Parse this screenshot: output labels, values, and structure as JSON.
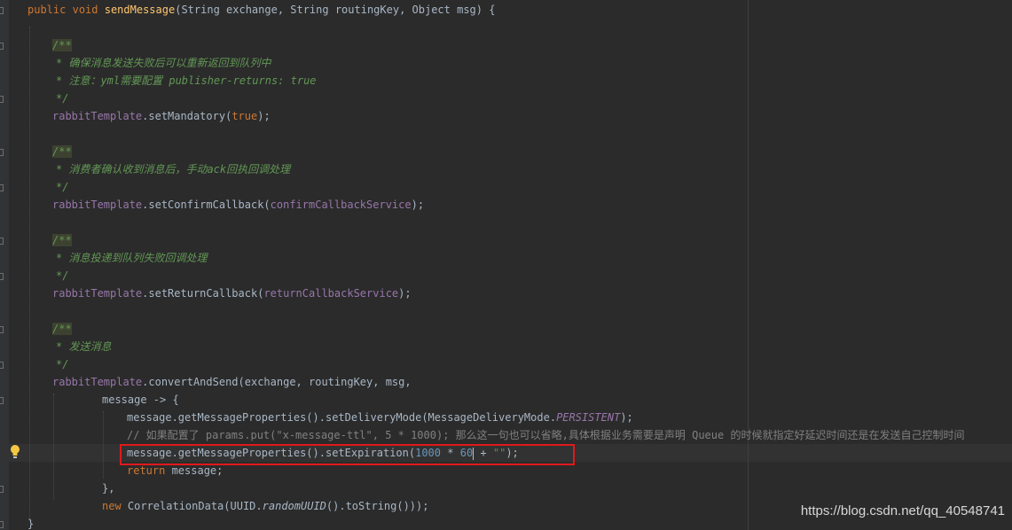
{
  "editor": {
    "colors": {
      "background": "#2b2b2b",
      "keyword": "#cc7832",
      "method": "#ffc66d",
      "field": "#9876aa",
      "number": "#6897bb",
      "string": "#6a8759",
      "javadoc": "#629755",
      "comment": "#808080",
      "text": "#a9b7c6",
      "highlight_box": "#e0191c"
    },
    "icons": {
      "intention": "lightbulb-icon"
    },
    "code": {
      "sig_kw1": "public",
      "sig_kw2": "void",
      "sig_method": "sendMessage",
      "sig_params": "(String exchange, String routingKey, Object msg) {",
      "doc_open": "/**",
      "doc_close": "*/",
      "doc1_line1": "* 确保消息发送失败后可以重新返回到队列中",
      "doc1_line2": "* 注意：yml需要配置 publisher-returns: true",
      "stmt1_field": "rabbitTemplate",
      "stmt1_call": ".setMandatory(",
      "stmt1_arg": "true",
      "stmt1_end": ");",
      "doc2_line1": "* 消费者确认收到消息后，手动ack回执回调处理",
      "stmt2_field": "rabbitTemplate",
      "stmt2_call": ".setConfirmCallback(",
      "stmt2_arg": "confirmCallbackService",
      "stmt2_end": ");",
      "doc3_line1": "* 消息投递到队列失败回调处理",
      "stmt3_field": "rabbitTemplate",
      "stmt3_call": ".setReturnCallback(",
      "stmt3_arg": "returnCallbackService",
      "stmt3_end": ");",
      "doc4_line1": "* 发送消息",
      "stmt4_field": "rabbitTemplate",
      "stmt4_call": ".convertAndSend(exchange, routingKey, msg,",
      "lambda_start": "message -> {",
      "delivery_pre": "message.getMessageProperties().setDeliveryMode(MessageDeliveryMode.",
      "delivery_const": "PERSISTENT",
      "delivery_end": ");",
      "comment_line": "// 如果配置了 params.put(\"x-message-ttl\", 5 * 1000); 那么这一句也可以省略,具体根据业务需要是声明 Queue 的时候就指定好延迟时间还是在发送自己控制时间",
      "exp_pre": "message.getMessageProperties().setExpiration(",
      "exp_num1": "1000",
      "exp_mul": " * ",
      "exp_num2a": "6",
      "exp_num2b": "0",
      "exp_plus": " + ",
      "exp_str": "\"\"",
      "exp_end": ");",
      "return_kw": "return",
      "return_rest": " message;",
      "lambda_close": "},",
      "new_kw": "new",
      "corr_pre": " CorrelationData(UUID.",
      "corr_static": "randomUUID",
      "corr_end": "().toString()));",
      "method_close": "}"
    }
  },
  "watermark": "https://blog.csdn.net/qq_40548741"
}
